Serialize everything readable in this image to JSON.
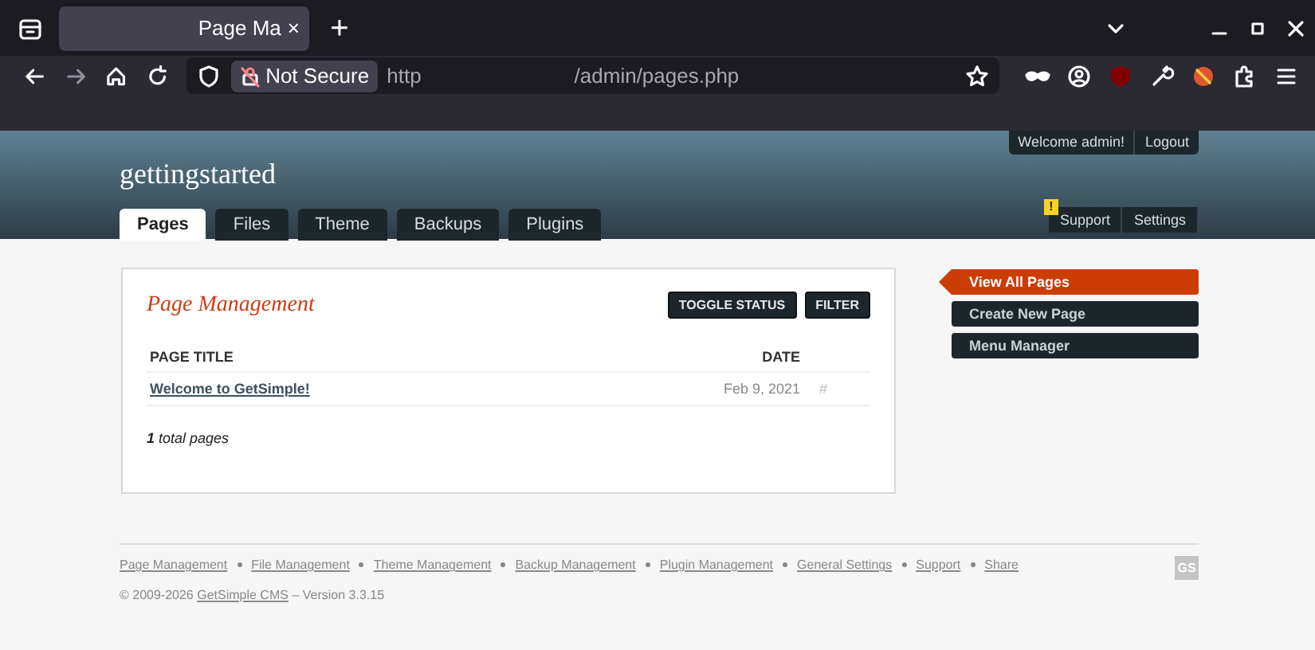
{
  "browser": {
    "tab_title": "Page Ma",
    "tab_close": "×",
    "new_tab": "+",
    "security": "Not Secure",
    "url_start": "http",
    "url_end": "/admin/pages.php"
  },
  "header": {
    "site_name": "gettingstarted",
    "user_links": [
      {
        "label": "Welcome admin!"
      },
      {
        "label": "Logout"
      }
    ],
    "tabs": [
      {
        "label": "Pages",
        "selected": true
      },
      {
        "label": "Files",
        "selected": false
      },
      {
        "label": "Theme",
        "selected": false
      },
      {
        "label": "Backups",
        "selected": false
      },
      {
        "label": "Plugins",
        "selected": false
      }
    ],
    "alert_badge": "!",
    "right_links": [
      {
        "label": "Support"
      },
      {
        "label": "Settings"
      }
    ]
  },
  "panel": {
    "title": "Page Management",
    "buttons": [
      "TOGGLE STATUS",
      "FILTER"
    ],
    "columns": [
      "PAGE TITLE",
      "DATE"
    ],
    "rows": [
      {
        "title": "Welcome to GetSimple!",
        "date": "Feb 9, 2021",
        "marker": "#"
      }
    ],
    "total": "**1** total pages"
  },
  "sidebar": {
    "items": [
      {
        "label": "View All Pages",
        "selected": true
      },
      {
        "label": "Create New Page",
        "selected": false
      },
      {
        "label": "Menu Manager",
        "selected": false
      }
    ]
  },
  "footer": {
    "links": [
      "Page Management",
      "File Management",
      "Theme Management",
      "Backup Management",
      "Plugin Management",
      "General Settings",
      "Support",
      "Share"
    ],
    "copyright": "© 2009-2026",
    "cms_link": "GetSimple CMS",
    "version": "– Version 3.3.15",
    "logo": "GS"
  }
}
